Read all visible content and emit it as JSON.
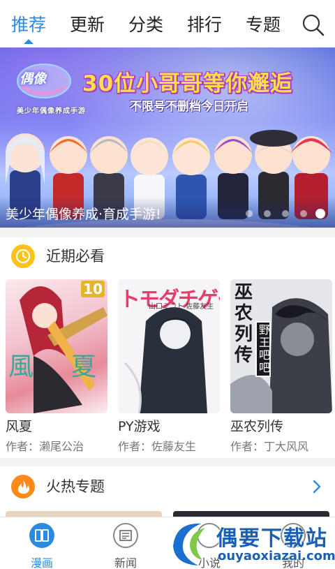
{
  "topnav": {
    "tabs": [
      {
        "label": "推荐",
        "active": true
      },
      {
        "label": "更新"
      },
      {
        "label": "分类"
      },
      {
        "label": "排行"
      },
      {
        "label": "专题"
      }
    ],
    "search_icon": "search-icon",
    "active_color": "#2a8be0"
  },
  "banner": {
    "headline": "30位小哥哥等你邂逅",
    "subline": "不限号不删档今日开启",
    "logo_text": "偶像",
    "logo_sub": "美少年偶像养成手游",
    "caption": "美少年偶像养成·育成手游!",
    "page_count": 5,
    "active_page": 5
  },
  "recent": {
    "title": "近期必看",
    "icon": "clock-icon",
    "items": [
      {
        "title": "风夏",
        "author": "作者：濑尾公治",
        "cover_badge": "10",
        "cover_text_left": "風",
        "cover_text_right": "夏"
      },
      {
        "title": "PY游戏",
        "author": "作者：佐藤友生",
        "cover_text": "トモダチゲーム",
        "cover_credit": "山口ミコト 佐藤友生"
      },
      {
        "title": "巫农列传",
        "author": "作者：丁大风风",
        "cover_text": "巫农列传",
        "cover_box": "野王吧吧"
      }
    ]
  },
  "hot": {
    "title": "火热专题",
    "icon": "flame-icon",
    "arrow": "chevron-right-icon"
  },
  "bottombar": {
    "items": [
      {
        "label": "漫画",
        "icon": "book-icon",
        "active": true
      },
      {
        "label": "新闻",
        "icon": "news-icon"
      },
      {
        "label": "小说",
        "icon": "novel-icon"
      },
      {
        "label": "我的",
        "icon": "user-icon"
      }
    ]
  },
  "watermark": {
    "text": "偶要下载站",
    "url": "ouyaoxiazai.com"
  }
}
